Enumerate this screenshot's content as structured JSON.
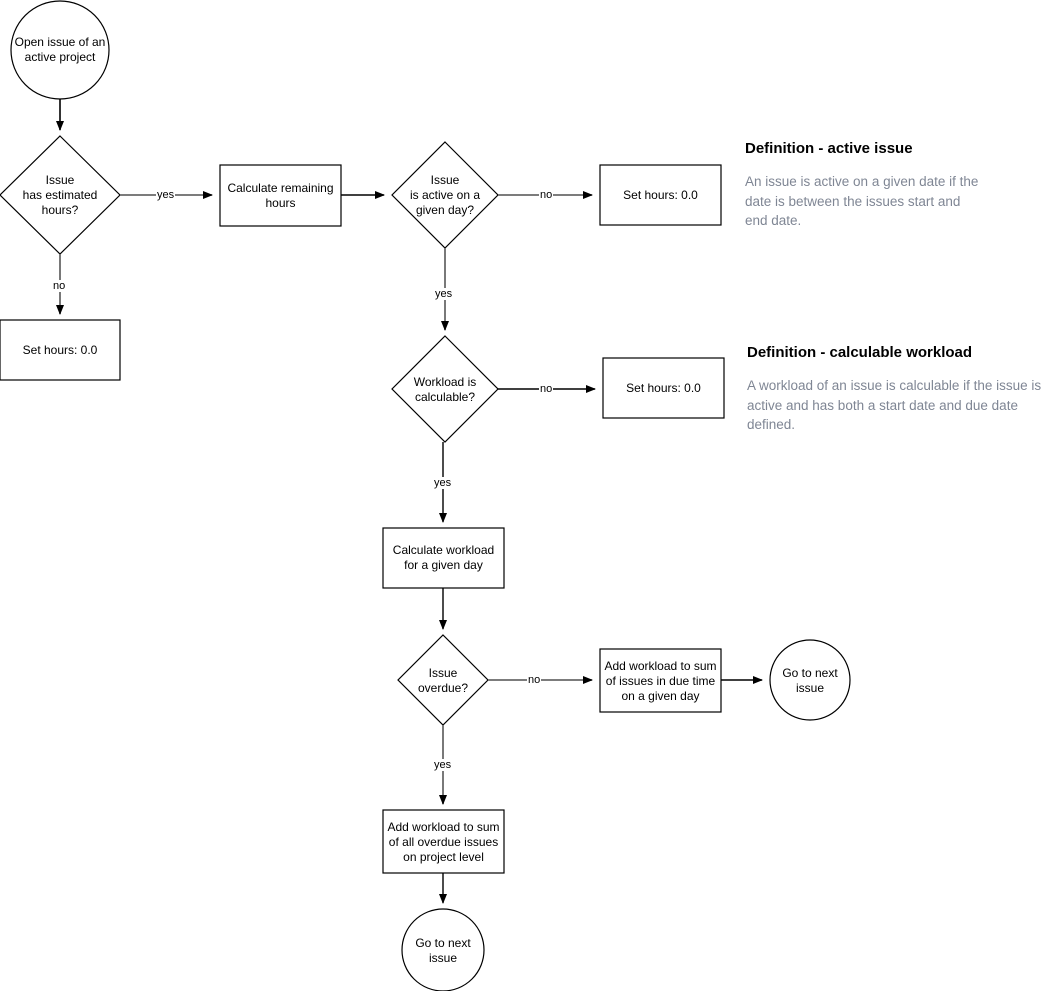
{
  "diagram": {
    "type": "flowchart",
    "title": "Issue workload calculation flowchart",
    "stroke_color": "#000000",
    "connector_color": "#6a6a6a",
    "definition_text_color": "#7f8694",
    "background": "#ffffff"
  },
  "nodes": {
    "start_open_issue": {
      "shape": "circle",
      "label": "Open issue of an\nactive project"
    },
    "q_has_estimated_hours": {
      "shape": "diamond",
      "label": "Issue\nhas estimated\nhours?"
    },
    "set_hours_left": {
      "shape": "rect",
      "label": "Set hours: 0.0"
    },
    "calculate_remaining_hours": {
      "shape": "rect",
      "label": "Calculate remaining\nhours"
    },
    "q_is_active_given_day": {
      "shape": "diamond",
      "label": "Issue\nis active on a\ngiven day?"
    },
    "set_hours_active": {
      "shape": "rect",
      "label": "Set hours: 0.0"
    },
    "q_workload_calculable": {
      "shape": "diamond",
      "label": "Workload  is\ncalculable?"
    },
    "set_hours_calculable": {
      "shape": "rect",
      "label": "Set hours: 0.0"
    },
    "calculate_workload_day": {
      "shape": "rect",
      "label": "Calculate workload\nfor a given day"
    },
    "q_issue_overdue": {
      "shape": "diamond",
      "label": "Issue\noverdue?"
    },
    "add_workload_due_time": {
      "shape": "rect",
      "label": "Add workload to sum\nof issues in due time\non a given day"
    },
    "go_next_issue_right": {
      "shape": "circle",
      "label": "Go to next\nissue"
    },
    "add_workload_overdue": {
      "shape": "rect",
      "label": "Add workload to sum\nof all overdue issues\non project level"
    },
    "go_next_issue_bottom": {
      "shape": "circle",
      "label": "Go to next\nissue"
    }
  },
  "edge_labels": {
    "estimated_yes": "yes",
    "estimated_no": "no",
    "active_no": "no",
    "active_yes": "yes",
    "calculable_no": "no",
    "calculable_yes": "yes",
    "overdue_no": "no",
    "overdue_yes": "yes"
  },
  "definitions": [
    {
      "title": "Definition - active issue",
      "body": "An issue is active on a given date if the date is between the issues start and end date."
    },
    {
      "title": "Definition - calculable workload",
      "body": "A workload of an issue is calculable if the issue is active and has both a start date and due date defined."
    }
  ]
}
